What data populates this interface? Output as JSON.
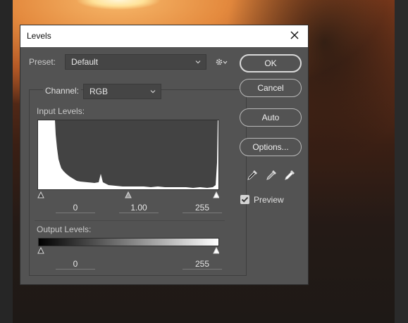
{
  "dialog": {
    "title": "Levels",
    "close_icon": "close-icon",
    "preset": {
      "label": "Preset:",
      "value": "Default"
    },
    "gear_icon": "gear-icon",
    "channel": {
      "label": "Channel:",
      "value": "RGB"
    },
    "input_levels": {
      "label": "Input Levels:",
      "black": "0",
      "gamma": "1.00",
      "white": "255"
    },
    "output_levels": {
      "label": "Output Levels:",
      "black": "0",
      "white": "255"
    },
    "buttons": {
      "ok": "OK",
      "cancel": "Cancel",
      "auto": "Auto",
      "options": "Options..."
    },
    "eyedroppers": [
      "black-eyedropper-icon",
      "gray-eyedropper-icon",
      "white-eyedropper-icon"
    ],
    "preview": {
      "label": "Preview",
      "checked": true
    }
  },
  "colors": {
    "dialog_bg": "#535353",
    "histogram_bg": "#434343",
    "histogram_fill": "#ffffff"
  }
}
